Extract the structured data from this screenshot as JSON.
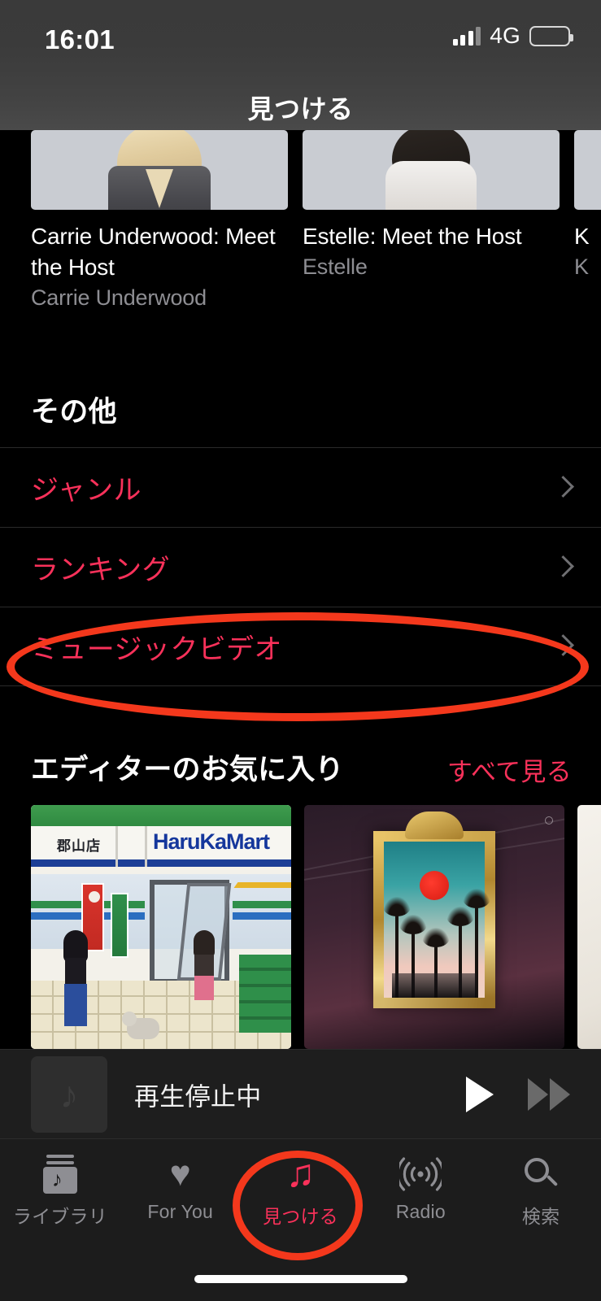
{
  "status_bar": {
    "time": "16:01",
    "network": "4G",
    "signal_icon": "signal-bars-icon",
    "battery_icon": "battery-full-icon"
  },
  "nav_bar": {
    "title": "見つける"
  },
  "video_carousel": {
    "cards": [
      {
        "title": "Carrie Underwood: Meet the Host",
        "subtitle": "Carrie Underwood"
      },
      {
        "title": "Estelle: Meet the Host",
        "subtitle": "Estelle"
      },
      {
        "title": "K",
        "subtitle": "K"
      }
    ]
  },
  "other_section": {
    "heading": "その他",
    "items": [
      {
        "label": "ジャンル",
        "chevron_icon": "chevron-right-icon"
      },
      {
        "label": "ランキング",
        "chevron_icon": "chevron-right-icon"
      },
      {
        "label": "ミュージックビデオ",
        "chevron_icon": "chevron-right-icon"
      }
    ]
  },
  "editor_section": {
    "heading": "エディターのお気に入り",
    "see_all": "すべて見る",
    "albums": [
      {
        "art_label_brand": "HaruKaMart",
        "art_label_store": "郡山店"
      },
      {
        "art_label_brand": "",
        "art_label_store": ""
      },
      {
        "art_label_brand": "",
        "art_label_store": ""
      }
    ]
  },
  "mini_player": {
    "title": "再生停止中",
    "artwork_icon": "music-note-icon",
    "play_icon": "play-icon",
    "next_icon": "fast-forward-icon"
  },
  "tab_bar": {
    "tabs": [
      {
        "label": "ライブラリ",
        "icon": "library-icon",
        "active": false
      },
      {
        "label": "For You",
        "icon": "heart-icon",
        "active": false
      },
      {
        "label": "見つける",
        "icon": "music-note-icon",
        "active": true
      },
      {
        "label": "Radio",
        "icon": "radio-waves-icon",
        "active": false
      },
      {
        "label": "検索",
        "icon": "search-icon",
        "active": false
      }
    ]
  },
  "annotations": {
    "color": "#F4381C",
    "shapes": [
      {
        "name": "highlight-music-video-row",
        "type": "ellipse"
      },
      {
        "name": "highlight-discover-tab",
        "type": "ellipse"
      }
    ]
  }
}
